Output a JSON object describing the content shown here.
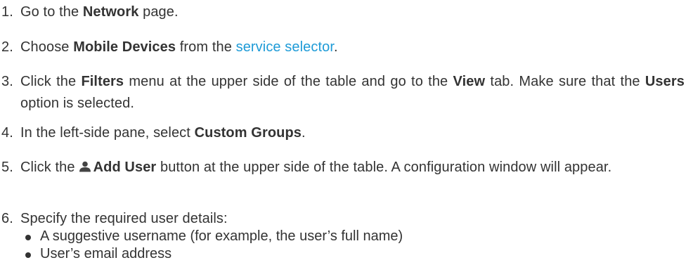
{
  "steps": [
    {
      "num": "1.",
      "pre": "Go to the ",
      "b1": "Network",
      "post": " page."
    },
    {
      "num": "2.",
      "pre": "Choose ",
      "b1": "Mobile Devices",
      "mid": " from the ",
      "link": "service selector",
      "post": "."
    },
    {
      "num": "3.",
      "pre": "Click the ",
      "b1": "Filters",
      "mid": " menu at the upper side of the table and go to the ",
      "b2": "View",
      "mid2": " tab. Make sure that the ",
      "b3": "Users",
      "post": " option is selected."
    },
    {
      "num": "4.",
      "pre": "In the left-side pane, select ",
      "b1": "Custom Groups",
      "post": "."
    },
    {
      "num": "5.",
      "pre": "Click the",
      "icon": "user-icon",
      "b1": "Add User",
      "post": " button at the upper side of the table. A configuration window will appear."
    },
    {
      "num": "6.",
      "text": "Specify the required user details:",
      "bullets": [
        "A suggestive username (for example, the user’s full name)",
        "User’s email address"
      ]
    }
  ],
  "colors": {
    "text": "#333333",
    "link": "#1e9bd7",
    "icon": "#444444"
  }
}
